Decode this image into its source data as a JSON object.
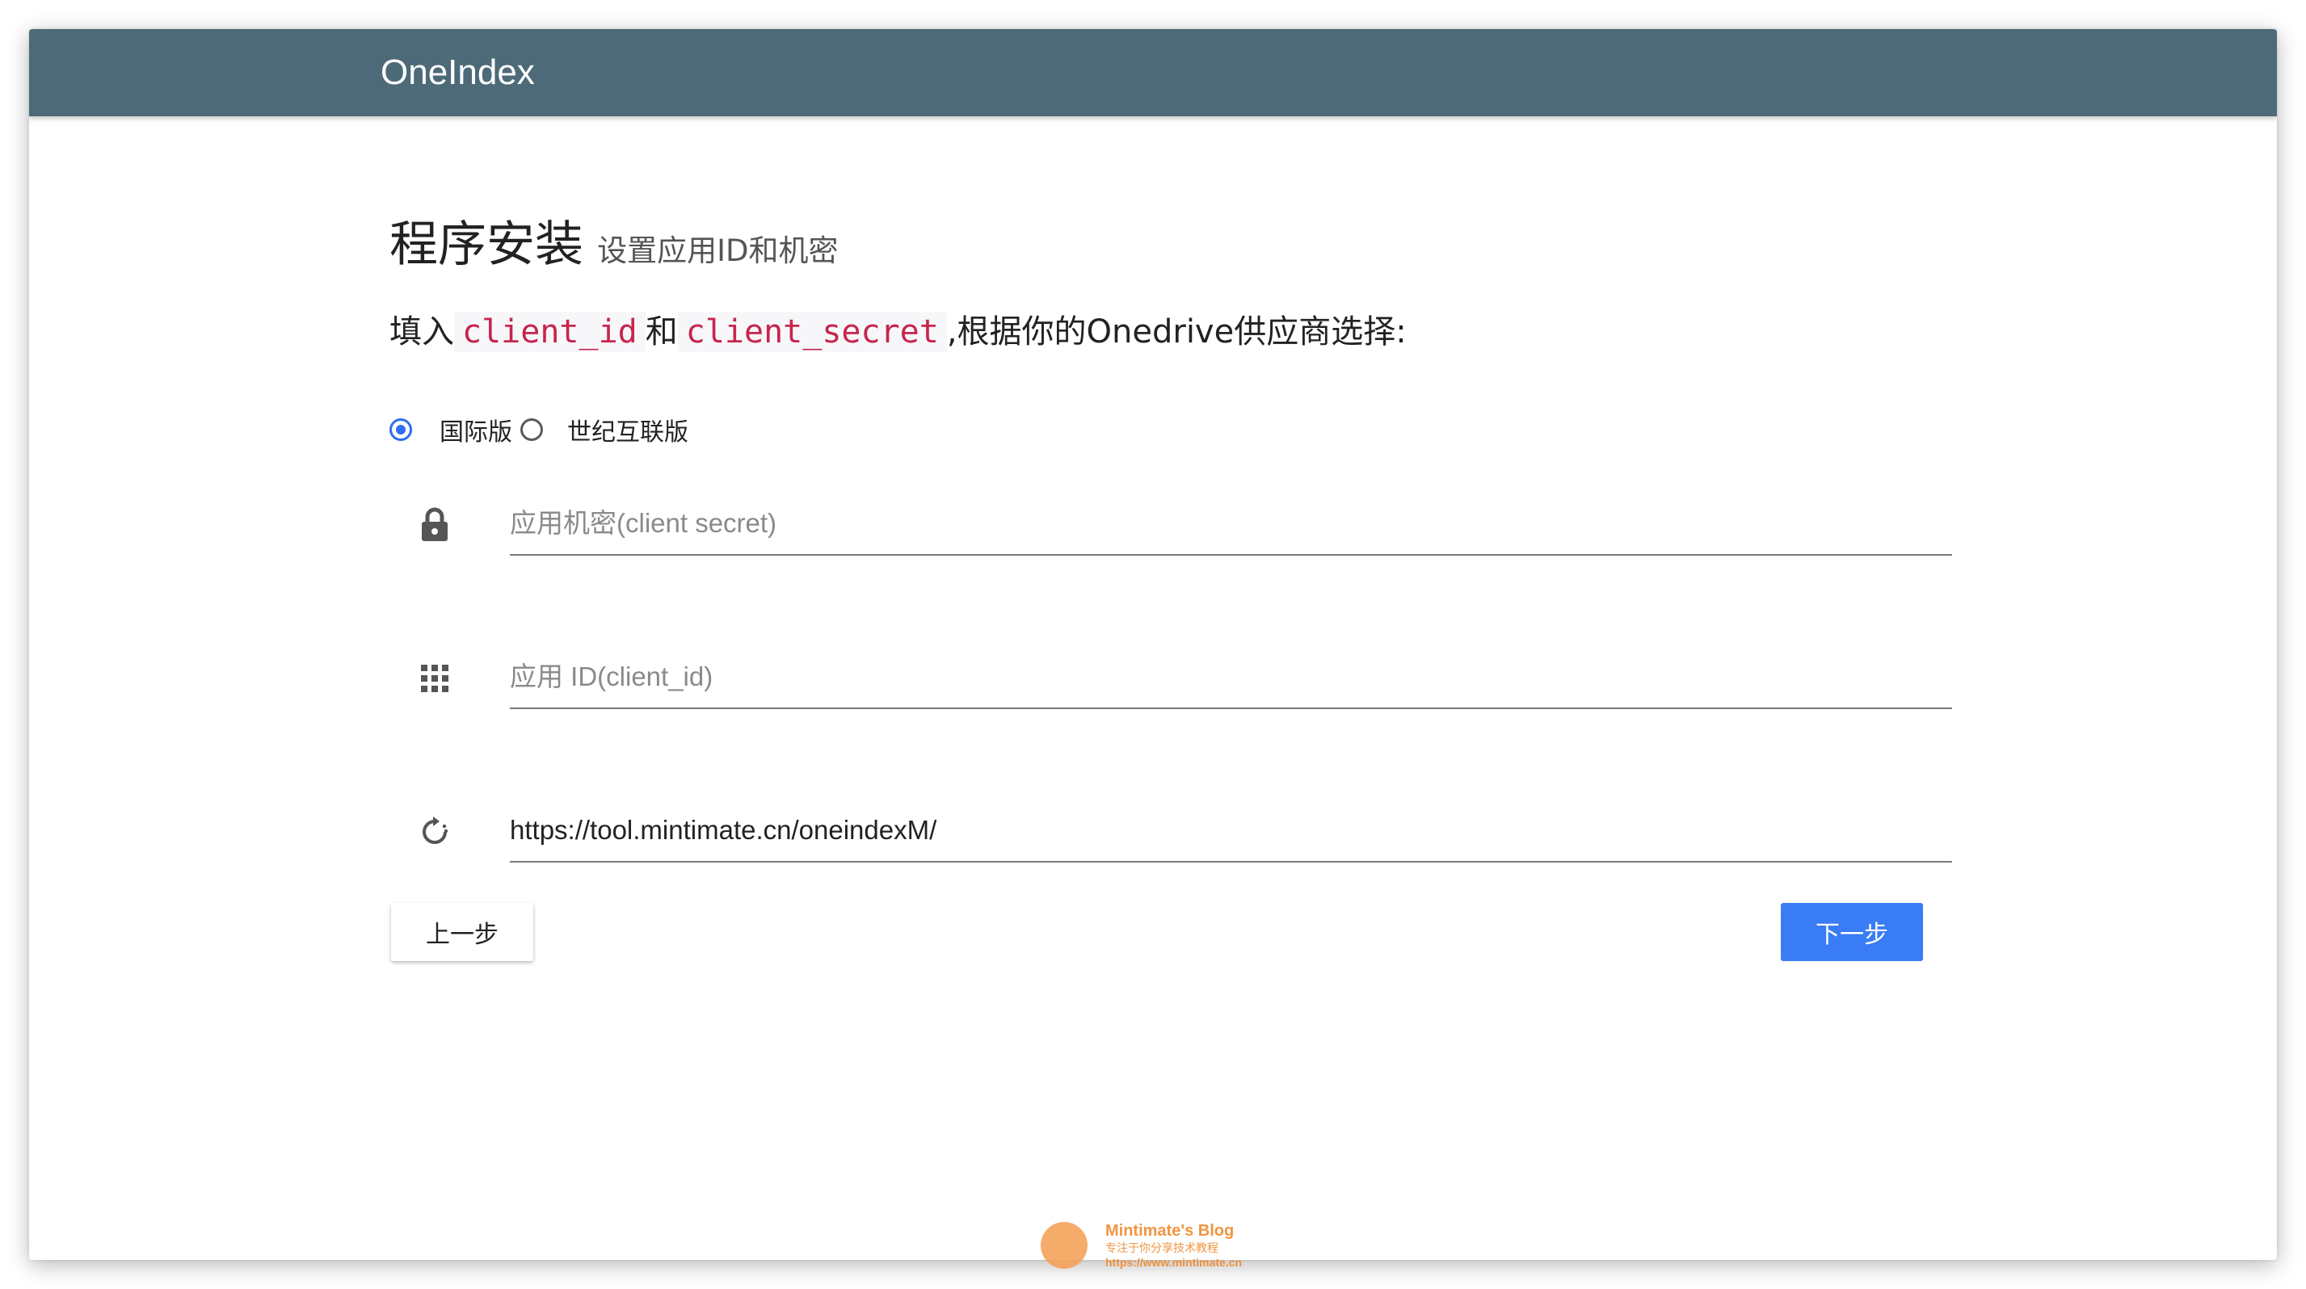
{
  "app": {
    "title": "OneIndex"
  },
  "heading": {
    "main": "程序安装",
    "sub": "设置应用ID和机密"
  },
  "instruction": {
    "prefix": "填入",
    "code1": "client_id",
    "middle": "和",
    "code2": "client_secret",
    "suffix": ",根据你的Onedrive供应商选择:"
  },
  "provider": {
    "options": [
      {
        "label": "国际版",
        "checked": true
      },
      {
        "label": "世纪互联版",
        "checked": false
      }
    ]
  },
  "fields": {
    "client_secret": {
      "icon": "lock-icon",
      "placeholder": "应用机密(client secret)",
      "value": ""
    },
    "client_id": {
      "icon": "apps-grid-icon",
      "placeholder": "应用 ID(client_id)",
      "value": ""
    },
    "redirect_uri": {
      "icon": "refresh-icon",
      "placeholder": "",
      "value": "https://tool.mintimate.cn/oneindexM/"
    }
  },
  "buttons": {
    "prev": "上一步",
    "next": "下一步"
  },
  "watermark": {
    "title": "Mintimate's Blog",
    "subtitle": "专注于你分享技术教程",
    "url": "https://www.mintimate.cn"
  },
  "colors": {
    "appbar": "#4d6a78",
    "accent": "#3a7cf5",
    "code": "#c7254e"
  }
}
